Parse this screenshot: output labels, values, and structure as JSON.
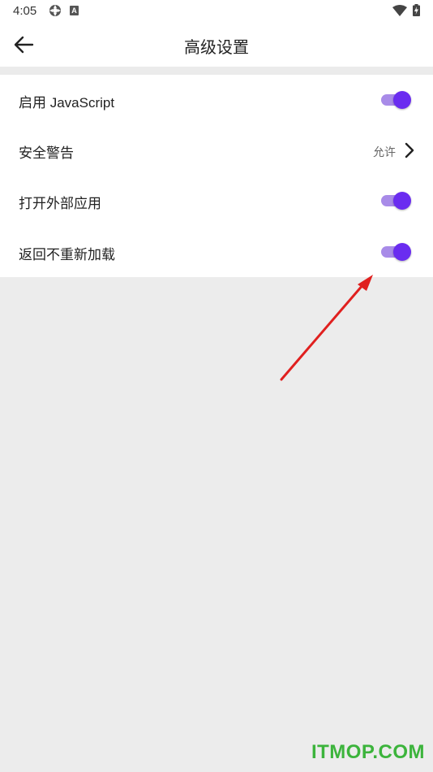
{
  "status_bar": {
    "time": "4:05",
    "icons": [
      "settings-gear-icon",
      "a-badge-icon",
      "wifi-icon",
      "battery-charging-icon"
    ],
    "a_badge_text": "A"
  },
  "app_bar": {
    "back_icon": "arrow-left-icon",
    "title": "高级设置"
  },
  "settings": {
    "items": [
      {
        "label": "启用 JavaScript",
        "type": "toggle",
        "enabled": true
      },
      {
        "label": "安全警告",
        "type": "link",
        "value": "允许",
        "icon": "chevron-right-icon"
      },
      {
        "label": "打开外部应用",
        "type": "toggle",
        "enabled": true
      },
      {
        "label": "返回不重新加载",
        "type": "toggle",
        "enabled": true
      }
    ]
  },
  "colors": {
    "toggle_on_knob": "#6a2cf0",
    "toggle_on_track": "#a88be8",
    "annotation_arrow": "#e0201f",
    "watermark": "#3cb43c",
    "background": "#ececec"
  },
  "watermark": {
    "text": "ITMOP.COM"
  }
}
